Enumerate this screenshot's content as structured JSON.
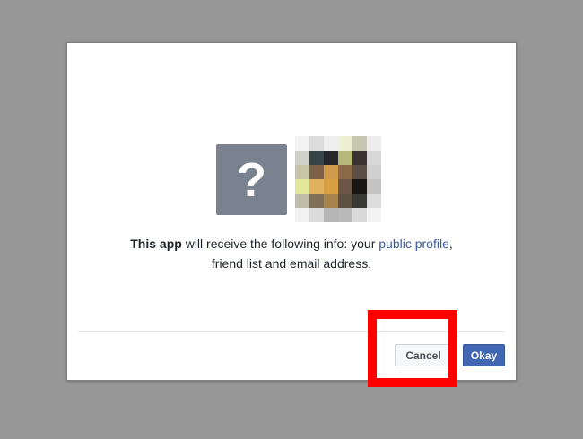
{
  "dialog": {
    "app_icon_glyph": "?",
    "info": {
      "app_name": "This app",
      "text_before_link": " will receive the following info: your ",
      "link_text": "public profile",
      "text_after_link": ", friend list and email address."
    },
    "buttons": {
      "cancel_label": "Cancel",
      "okay_label": "Okay"
    }
  },
  "avatar": {
    "pixel_colors": [
      "#f3f3f3",
      "#dcdcdc",
      "#eeeeee",
      "#edf0d2",
      "#c5c7b0",
      "#ededed",
      "#cfd1c9",
      "#374347",
      "#25262a",
      "#b6b978",
      "#3b3330",
      "#d7d7d7",
      "#c7c4a8",
      "#7d6147",
      "#d19b4e",
      "#8b6a49",
      "#5b4e43",
      "#cfcfcf",
      "#e2e699",
      "#dfb15d",
      "#d99f45",
      "#6c5649",
      "#181614",
      "#c3c3c3",
      "#bfbcaa",
      "#826f57",
      "#a7834d",
      "#5c5244",
      "#383932",
      "#dcdcdc",
      "#f2f2f2",
      "#dbdbdb",
      "#b5b5b5",
      "#b9b9b9",
      "#dadada",
      "#f4f4f4"
    ]
  },
  "colors": {
    "link": "#3b5998",
    "primary_button": "#4267b2",
    "highlight_box": "#ff0000"
  }
}
